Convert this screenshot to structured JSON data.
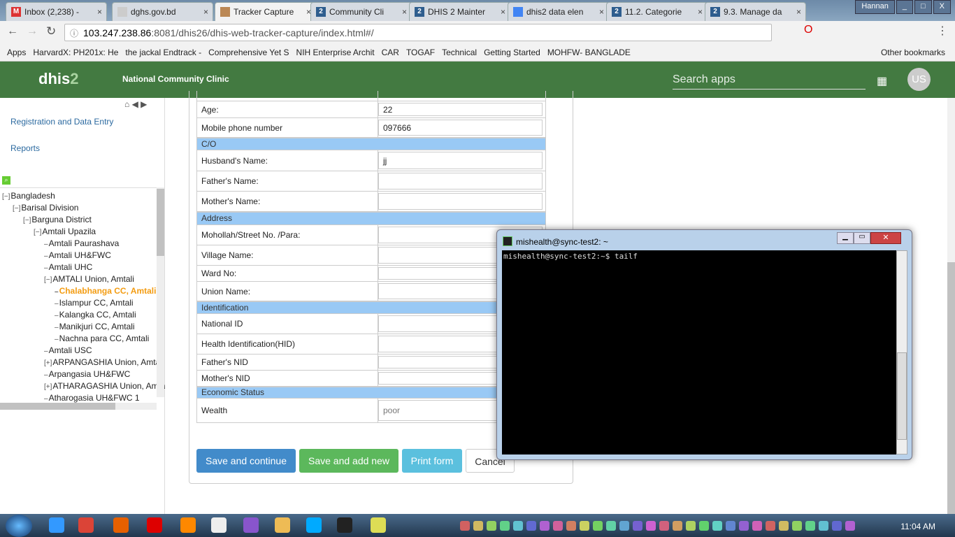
{
  "browser": {
    "tabs": [
      "Inbox (2,238) -",
      "dghs.gov.bd",
      "Tracker Capture",
      "Community Cli",
      "DHIS 2 Mainter",
      "dhis2 data elen",
      "11.2. Categorie",
      "9.3. Manage da"
    ],
    "user_badge": "Hannan",
    "url_host": "103.247.238.86",
    "url_path": ":8081/dhis26/dhis-web-tracker-capture/index.html#/",
    "bookmarks": [
      "Apps",
      "HarvardX: PH201x: He",
      "the jackal Endtrack -",
      "Comprehensive Yet S",
      "NIH Enterprise Archit",
      "CAR",
      "TOGAF",
      "Technical",
      "Getting Started",
      "MOHFW- BANGLADE",
      "Other bookmarks"
    ]
  },
  "header": {
    "logo_a": "dhis",
    "logo_b": "2",
    "title": "National Community Clinic",
    "search_placeholder": "Search apps",
    "avatar": "US"
  },
  "sidebar": {
    "links": [
      "Registration and Data Entry",
      "Reports"
    ],
    "tree": [
      {
        "label": "Bangladesh",
        "lvl": 0,
        "sign": "−"
      },
      {
        "label": "Barisal Division",
        "lvl": 1,
        "sign": "−"
      },
      {
        "label": "Barguna District",
        "lvl": 2,
        "sign": "−"
      },
      {
        "label": "Amtali Upazila",
        "lvl": 3,
        "sign": "−"
      },
      {
        "label": "Amtali Paurashava",
        "lvl": 4,
        "sign": ""
      },
      {
        "label": "Amtali UH&FWC",
        "lvl": 4,
        "sign": ""
      },
      {
        "label": "Amtali UHC",
        "lvl": 4,
        "sign": ""
      },
      {
        "label": "AMTALI Union, Amtali",
        "lvl": 4,
        "sign": "−"
      },
      {
        "label": "Chalabhanga CC, Amtali",
        "lvl": 5,
        "sign": "",
        "sel": true
      },
      {
        "label": "Islampur CC, Amtali",
        "lvl": 5,
        "sign": ""
      },
      {
        "label": "Kalangka CC, Amtali",
        "lvl": 5,
        "sign": ""
      },
      {
        "label": "Manikjuri CC, Amtali",
        "lvl": 5,
        "sign": ""
      },
      {
        "label": "Nachna para CC, Amtali",
        "lvl": 5,
        "sign": ""
      },
      {
        "label": "Amtali USC",
        "lvl": 4,
        "sign": ""
      },
      {
        "label": "ARPANGASHIA Union, Amtali",
        "lvl": 4,
        "sign": "+"
      },
      {
        "label": "Arpangasia UH&FWC",
        "lvl": 4,
        "sign": ""
      },
      {
        "label": "ATHARAGASHIA Union, Amtali",
        "lvl": 4,
        "sign": "+"
      },
      {
        "label": "Atharogasia UH&FWC 1",
        "lvl": 4,
        "sign": ""
      }
    ]
  },
  "form": {
    "rows": [
      {
        "type": "row",
        "label": "Age:",
        "value": "22"
      },
      {
        "type": "row",
        "label": "Mobile phone number",
        "value": "097666"
      },
      {
        "type": "sect",
        "label": "C/O"
      },
      {
        "type": "row",
        "label": "Husband's Name:",
        "value": "jj"
      },
      {
        "type": "row",
        "label": "Father's Name:",
        "value": ""
      },
      {
        "type": "row",
        "label": "Mother's Name:",
        "value": ""
      },
      {
        "type": "sect",
        "label": "Address"
      },
      {
        "type": "row",
        "label": "Mohollah/Street No. /Para:",
        "value": ""
      },
      {
        "type": "row",
        "label": "Village Name:",
        "value": ""
      },
      {
        "type": "row",
        "label": "Ward No:",
        "value": ""
      },
      {
        "type": "row",
        "label": "Union Name:",
        "value": ""
      },
      {
        "type": "sect",
        "label": "Identification"
      },
      {
        "type": "row",
        "label": "National ID",
        "value": ""
      },
      {
        "type": "row",
        "label": "Health Identification(HID)",
        "value": ""
      },
      {
        "type": "row",
        "label": "Father's NID",
        "value": ""
      },
      {
        "type": "row",
        "label": "Mother's NID",
        "value": ""
      },
      {
        "type": "sect",
        "label": "Economic Status"
      },
      {
        "type": "row",
        "label": "Wealth",
        "value": "poor"
      }
    ],
    "buttons": {
      "save_continue": "Save and continue",
      "save_new": "Save and add new",
      "print": "Print form",
      "cancel": "Cancel"
    }
  },
  "terminal": {
    "title": "mishealth@sync-test2: ~",
    "line": "mishealth@sync-test2:~$ tailf"
  },
  "taskbar": {
    "clock": "11:04 AM"
  }
}
